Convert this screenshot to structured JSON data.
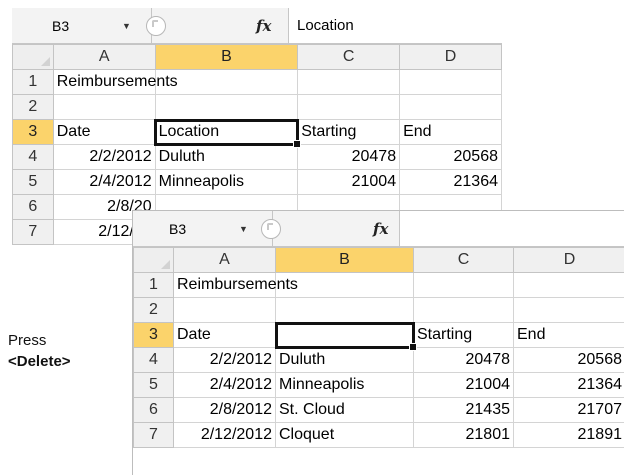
{
  "sheet1": {
    "name_box": "B3",
    "fx_symbol": "fx",
    "formula_text": "Location",
    "columns": [
      "A",
      "B",
      "C",
      "D"
    ],
    "rows": [
      {
        "num": "1",
        "date": "Reimbursements",
        "location": "",
        "starting": "",
        "end": ""
      },
      {
        "num": "2",
        "date": "",
        "location": "",
        "starting": "",
        "end": ""
      },
      {
        "num": "3",
        "date": "Date",
        "location": "Location",
        "starting": "Starting",
        "end": "End"
      },
      {
        "num": "4",
        "date": "2/2/2012",
        "location": "Duluth",
        "starting": "20478",
        "end": "20568"
      },
      {
        "num": "5",
        "date": "2/4/2012",
        "location": "Minneapolis",
        "starting": "21004",
        "end": "21364"
      },
      {
        "num": "6",
        "date": "2/8/20",
        "location": "",
        "starting": "",
        "end": ""
      },
      {
        "num": "7",
        "date": "2/12/20",
        "location": "",
        "starting": "",
        "end": ""
      }
    ]
  },
  "sheet2": {
    "name_box": "B3",
    "fx_symbol": "fx",
    "formula_text": "",
    "columns": [
      "A",
      "B",
      "C",
      "D"
    ],
    "rows": [
      {
        "num": "1",
        "date": "Reimbursements",
        "location": "",
        "starting": "",
        "end": ""
      },
      {
        "num": "2",
        "date": "",
        "location": "",
        "starting": "",
        "end": ""
      },
      {
        "num": "3",
        "date": "Date",
        "location": "",
        "starting": "Starting",
        "end": "End"
      },
      {
        "num": "4",
        "date": "2/2/2012",
        "location": "Duluth",
        "starting": "20478",
        "end": "20568"
      },
      {
        "num": "5",
        "date": "2/4/2012",
        "location": "Minneapolis",
        "starting": "21004",
        "end": "21364"
      },
      {
        "num": "6",
        "date": "2/8/2012",
        "location": "St. Cloud",
        "starting": "21435",
        "end": "21707"
      },
      {
        "num": "7",
        "date": "2/12/2012",
        "location": "Cloquet",
        "starting": "21801",
        "end": "21891"
      }
    ]
  },
  "caption": {
    "line1": "Press",
    "line2": "<Delete>"
  },
  "colors": {
    "active_header": "#fbd36b",
    "selection_border": "#111111",
    "header_bg": "#f0f0f0"
  }
}
